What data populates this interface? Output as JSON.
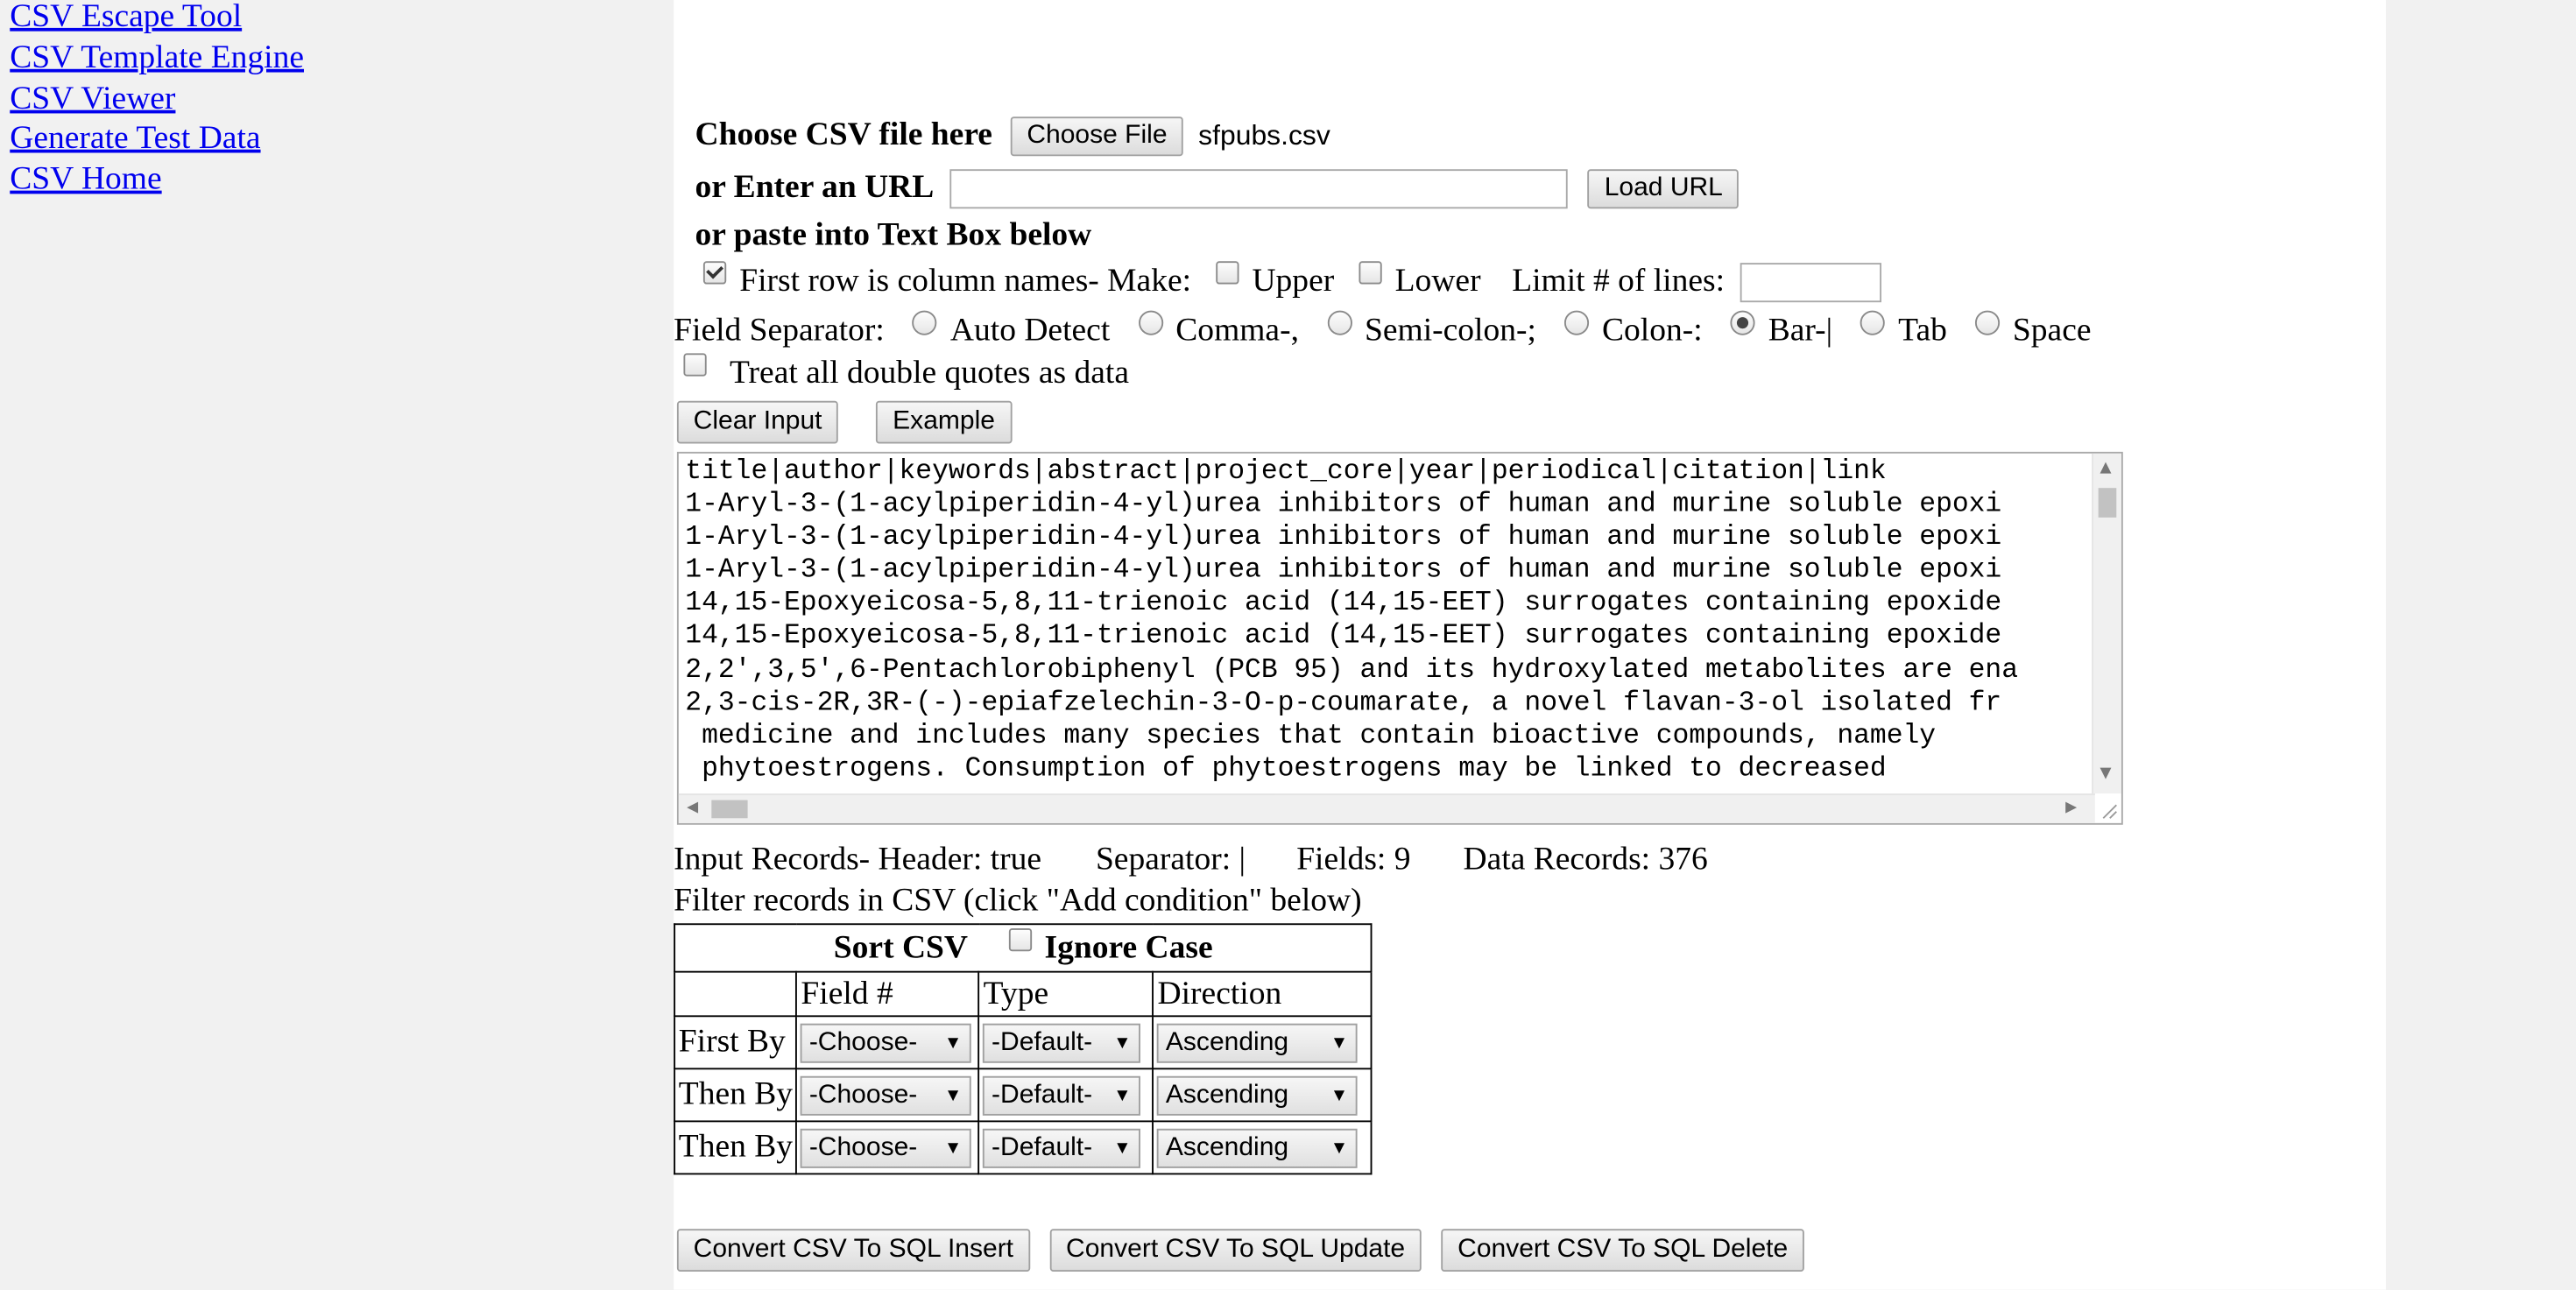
{
  "sidebar": {
    "links": [
      "CSV Escape Tool",
      "CSV Template Engine",
      "CSV Viewer",
      "Generate Test Data",
      "CSV Home"
    ]
  },
  "input": {
    "choose_label": "Choose CSV file here",
    "choose_button": "Choose File",
    "file_name": "sfpubs.csv",
    "url_label": "or Enter an URL",
    "url_value": "",
    "load_url_button": "Load URL",
    "paste_label": "or paste into Text Box below"
  },
  "options": {
    "first_row_label": "First row is column names- Make:",
    "first_row_checked": true,
    "upper_label": "Upper",
    "lower_label": "Lower",
    "limit_label": "Limit # of lines:",
    "limit_value": ""
  },
  "separator": {
    "label": "Field Separator:",
    "options": [
      "Auto Detect",
      "Comma-,",
      "Semi-colon-;",
      "Colon-:",
      "Bar-|",
      "Tab",
      "Space"
    ],
    "selected": "Bar-|"
  },
  "quotes": {
    "label": "Treat all double quotes as data"
  },
  "buttons": {
    "clear_input": "Clear Input",
    "example": "Example"
  },
  "csv_text": "title|author|keywords|abstract|project_core|year|periodical|citation|link\n1-Aryl-3-(1-acylpiperidin-4-yl)urea inhibitors of human and murine soluble epoxi\n1-Aryl-3-(1-acylpiperidin-4-yl)urea inhibitors of human and murine soluble epoxi\n1-Aryl-3-(1-acylpiperidin-4-yl)urea inhibitors of human and murine soluble epoxi\n14,15-Epoxyeicosa-5,8,11-trienoic acid (14,15-EET) surrogates containing epoxide\n14,15-Epoxyeicosa-5,8,11-trienoic acid (14,15-EET) surrogates containing epoxide\n2,2',3,5',6-Pentachlorobiphenyl (PCB 95) and its hydroxylated metabolites are ena\n2,3-cis-2R,3R-(-)-epiafzelechin-3-O-p-coumarate, a novel flavan-3-ol isolated fr\n medicine and includes many species that contain bioactive compounds, namely\n phytoestrogens. Consumption of phytoestrogens may be linked to decreased",
  "stats": {
    "header": "Input Records- Header: true",
    "separator": "Separator: |",
    "fields": "Fields: 9",
    "records": "Data Records: 376"
  },
  "filter_label": "Filter records in CSV (click \"Add condition\" below)",
  "sort": {
    "title": "Sort CSV",
    "ignore_case": "Ignore Case",
    "columns": [
      "Field #",
      "Type",
      "Direction"
    ],
    "rows": [
      {
        "label": "First By",
        "field": "-Choose-",
        "type": "-Default-",
        "direction": "Ascending"
      },
      {
        "label": "Then By",
        "field": "-Choose-",
        "type": "-Default-",
        "direction": "Ascending"
      },
      {
        "label": "Then By",
        "field": "-Choose-",
        "type": "-Default-",
        "direction": "Ascending"
      }
    ]
  },
  "convert": {
    "insert": "Convert CSV To SQL Insert",
    "update": "Convert CSV To SQL Update",
    "delete": "Convert CSV To SQL Delete"
  }
}
